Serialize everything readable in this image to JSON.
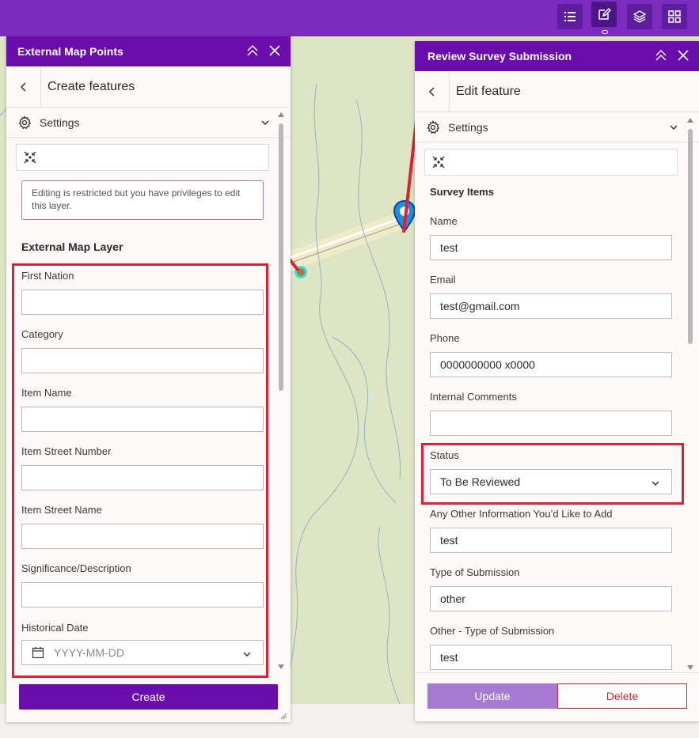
{
  "topbar": {
    "icons": [
      "list-icon",
      "edit-icon",
      "layers-icon",
      "grid-icon"
    ]
  },
  "left_panel": {
    "title": "External Map Points",
    "subhead": "Create features",
    "settings_label": "Settings",
    "notice": "Editing is restricted but you have privileges to edit this layer.",
    "layer_title": "External Map Layer",
    "fields": [
      {
        "label": "First Nation",
        "value": ""
      },
      {
        "label": "Category",
        "value": ""
      },
      {
        "label": "Item Name",
        "value": ""
      },
      {
        "label": "Item Street Number",
        "value": ""
      },
      {
        "label": "Item Street Name",
        "value": ""
      },
      {
        "label": "Significance/Description",
        "value": ""
      }
    ],
    "date_field": {
      "label": "Historical Date",
      "placeholder": "YYYY-MM-DD"
    },
    "create_label": "Create"
  },
  "right_panel": {
    "title": "Review Survey Submission",
    "subhead": "Edit feature",
    "settings_label": "Settings",
    "section_title": "Survey Items",
    "fields": [
      {
        "label": "Name",
        "value": "test"
      },
      {
        "label": "Email",
        "value": "test@gmail.com"
      },
      {
        "label": "Phone",
        "value": "0000000000 x0000"
      },
      {
        "label": "Internal Comments",
        "value": ""
      }
    ],
    "status": {
      "label": "Status",
      "value": "To Be Reviewed"
    },
    "fields_after": [
      {
        "label": "Any Other Information You’d Like to Add",
        "value": "test"
      },
      {
        "label": "Type of Submission",
        "value": "other"
      },
      {
        "label": "Other - Type of Submission",
        "value": "test"
      }
    ],
    "update_label": "Update",
    "delete_label": "Delete"
  },
  "colors": {
    "topbar": "#7b2cbf",
    "header": "#6a0dad",
    "highlight": "#e0202f",
    "map": "#dde5c4"
  }
}
